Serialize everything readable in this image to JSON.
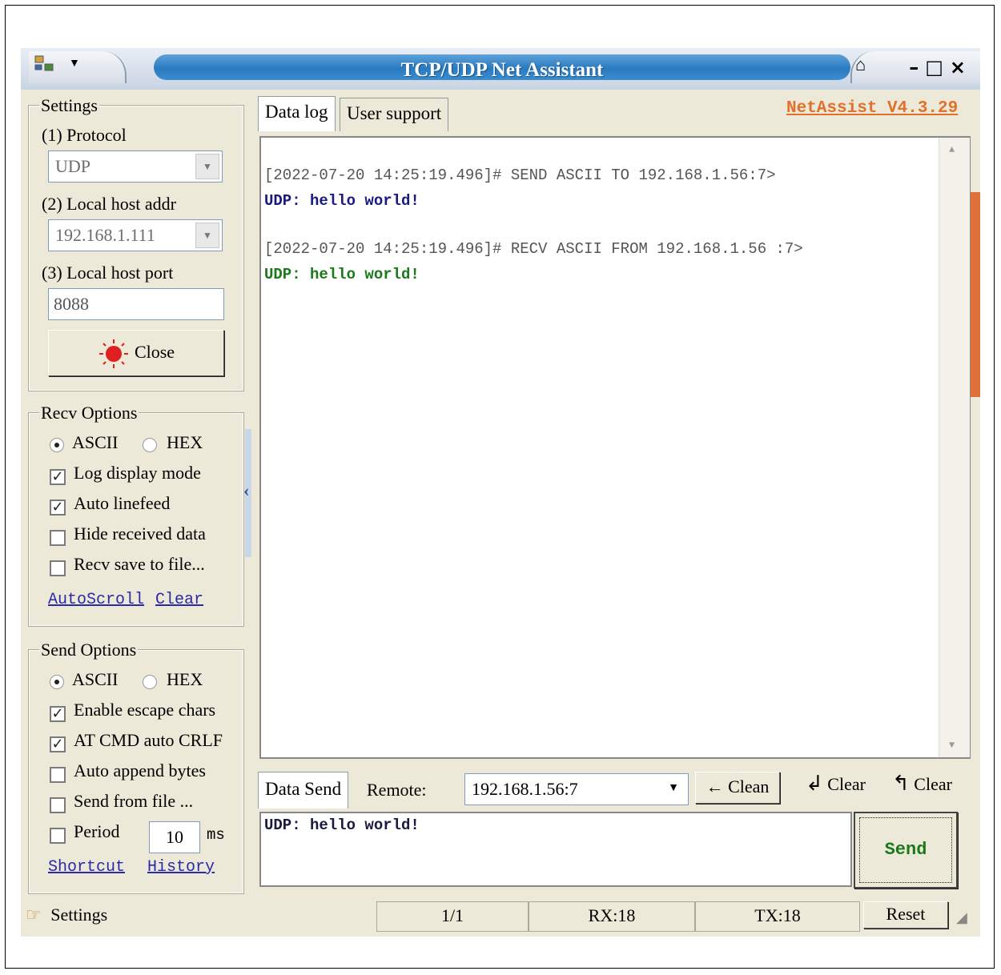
{
  "window": {
    "title": "TCP/UDP Net Assistant"
  },
  "settings": {
    "legend": "Settings",
    "protocol_label": "(1) Protocol",
    "protocol_value": "UDP",
    "local_addr_label": "(2) Local host addr",
    "local_addr_value": "192.168.1.111",
    "local_port_label": "(3) Local host port",
    "local_port_value": "8088",
    "close_label": "Close"
  },
  "recv_options": {
    "legend": "Recv Options",
    "ascii": "ASCII",
    "hex": "HEX",
    "log_display": "Log display mode",
    "auto_linefeed": "Auto linefeed",
    "hide_received": "Hide received data",
    "recv_save": "Recv save to file...",
    "autoscroll": "AutoScroll",
    "clear": "Clear"
  },
  "send_options": {
    "legend": "Send Options",
    "ascii": "ASCII",
    "hex": "HEX",
    "escape_chars": "Enable escape chars",
    "at_cmd": "AT CMD auto CRLF",
    "auto_append": "Auto append bytes",
    "send_from_file": "Send from file ...",
    "period": "Period",
    "period_value": "10",
    "period_unit": "ms",
    "shortcut": "Shortcut",
    "history": "History"
  },
  "tabs": {
    "data_log": "Data log",
    "user_support": "User support"
  },
  "version": "NetAssist V4.3.29",
  "log": [
    {
      "text": "[2022-07-20 14:25:19.496]# SEND ASCII TO 192.168.1.56:7>",
      "color": "#555555"
    },
    {
      "text": "UDP: hello world!",
      "color": "#1a1a80"
    },
    {
      "text": "[2022-07-20 14:25:19.496]# RECV ASCII FROM 192.168.1.56 :7>",
      "color": "#555555"
    },
    {
      "text": "UDP: hello world!",
      "color": "#1a7a1a"
    }
  ],
  "send_bar": {
    "tab": "Data Send",
    "remote_label": "Remote:",
    "remote_value": "192.168.1.56:7",
    "clean": "Clean",
    "clear1": "Clear",
    "clear2": "Clear"
  },
  "send_text": "UDP: hello world!",
  "send_button": "Send",
  "status": {
    "settings": "Settings",
    "page": "1/1",
    "rx": "RX:18",
    "tx": "TX:18",
    "reset": "Reset"
  }
}
